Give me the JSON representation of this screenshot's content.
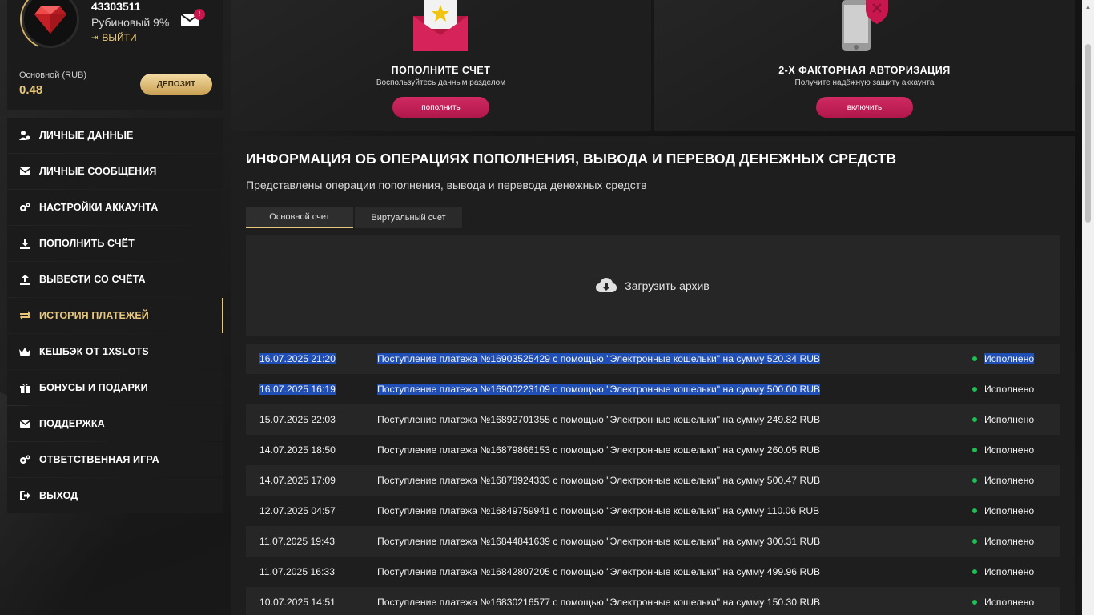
{
  "profile": {
    "user_id": "43303511",
    "level": "Рубиновый 9%",
    "logout_label": "ВЫЙТИ",
    "mail_badge": "!",
    "balance_label": "Основной (RUB)",
    "balance_value": "0.48",
    "deposit_label": "Депозит"
  },
  "menu": {
    "items": [
      {
        "label": "Личные данные",
        "icon": "user-gear-icon"
      },
      {
        "label": "Личные сообщения",
        "icon": "envelope-icon"
      },
      {
        "label": "Настройки аккаунта",
        "icon": "gears-icon"
      },
      {
        "label": "Пополнить счёт",
        "icon": "download-icon"
      },
      {
        "label": "Вывести со счёта",
        "icon": "upload-icon"
      },
      {
        "label": "История платежей",
        "icon": "exchange-icon",
        "active": true
      },
      {
        "label": "Кешбэк от 1XSLOTS",
        "icon": "crown-icon"
      },
      {
        "label": "Бонусы и подарки",
        "icon": "gift-icon"
      },
      {
        "label": "Поддержка",
        "icon": "envelope-icon"
      },
      {
        "label": "Ответственная игра",
        "icon": "gears-icon"
      },
      {
        "label": "Выход",
        "icon": "sign-out-icon"
      }
    ]
  },
  "cards": {
    "deposit": {
      "title": "ПОПОЛНИТЕ СЧЕТ",
      "subtitle": "Воспользуйтесь данным разделом",
      "button": "пополнить"
    },
    "twofa": {
      "title": "2-Х ФАКТОРНАЯ АВТОРИЗАЦИЯ",
      "subtitle": "Получите надёжную защиту аккаунта",
      "button": "включить"
    }
  },
  "main": {
    "title": "ИНФОРМАЦИЯ ОБ ОПЕРАЦИЯХ ПОПОЛНЕНИЯ, ВЫВОДА И ПЕРЕВОД ДЕНЕЖНЫХ СРЕДСТВ",
    "subtitle": "Представлены операции пополнения, вывода и перевода денежных средств",
    "tabs": [
      "Основной счет",
      "Виртуальный счет"
    ],
    "archive_label": "Загрузить архив"
  },
  "transactions": [
    {
      "date": "16.07.2025 21:20",
      "desc": "Поступление платежа №16903525429 с помощью \"Электронные кошельки\" на сумму 520.34 RUB",
      "status": "Исполнено"
    },
    {
      "date": "16.07.2025 16:19",
      "desc": "Поступление платежа №16900223109 с помощью \"Электронные кошельки\" на сумму 500.00 RUB",
      "status": "Исполнено"
    },
    {
      "date": "15.07.2025 22:03",
      "desc": "Поступление платежа №16892701355 с помощью \"Электронные кошельки\" на сумму 249.82 RUB",
      "status": "Исполнено"
    },
    {
      "date": "14.07.2025 18:50",
      "desc": "Поступление платежа №16879866153 с помощью \"Электронные кошельки\" на сумму 260.05 RUB",
      "status": "Исполнено"
    },
    {
      "date": "14.07.2025 17:09",
      "desc": "Поступление платежа №16878924333 с помощью \"Электронные кошельки\" на сумму 500.47 RUB",
      "status": "Исполнено"
    },
    {
      "date": "12.07.2025 04:57",
      "desc": "Поступление платежа №16849759941 с помощью \"Электронные кошельки\" на сумму 110.06 RUB",
      "status": "Исполнено"
    },
    {
      "date": "11.07.2025 19:43",
      "desc": "Поступление платежа №16844841639 с помощью \"Электронные кошельки\" на сумму 300.31 RUB",
      "status": "Исполнено"
    },
    {
      "date": "11.07.2025 16:33",
      "desc": "Поступление платежа №16842807205 с помощью \"Электронные кошельки\" на сумму 499.96 RUB",
      "status": "Исполнено"
    },
    {
      "date": "10.07.2025 14:51",
      "desc": "Поступление платежа №16830216577 с помощью \"Электронные кошельки\" на сумму 150.30 RUB",
      "status": "Исполнено"
    }
  ],
  "colors": {
    "accent_gold": "#e8c77b",
    "button_pink": "#c8174f",
    "status_green": "#1fbf55",
    "selection_blue": "#1f4fb4"
  }
}
